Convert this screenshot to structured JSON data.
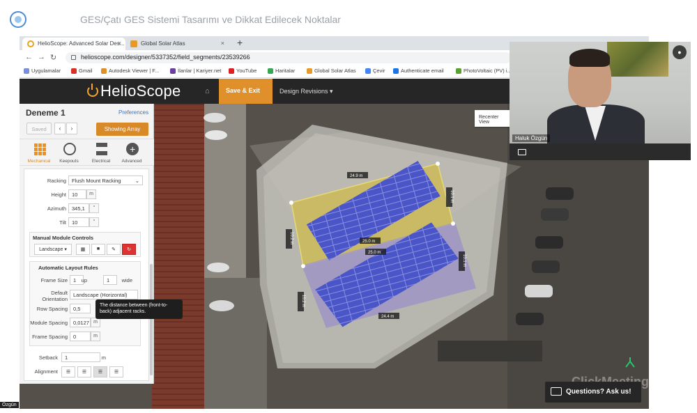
{
  "presentation": {
    "title": "GES/Çatı GES Sistemi Tasarımı ve Dikkat Edilecek Noktalar"
  },
  "browser": {
    "tabs": [
      {
        "label": "HelioScope: Advanced Solar Des...",
        "close": "×"
      },
      {
        "label": "Global Solar Atlas",
        "close": "×"
      }
    ],
    "new_tab": "+",
    "url": "helioscope.com/designer/5337352/field_segments/23539266",
    "bookmarks": [
      "Uygulamalar",
      "Gmail",
      "Autodesk Viewer | F...",
      "İlanlar | Kariyer.net",
      "YouTube",
      "Haritalar",
      "Global Solar Atlas",
      "Çevir",
      "Authenticate email",
      "PhotoVoltaic (PV) i..."
    ]
  },
  "app": {
    "brand": "HelioScope",
    "save_exit": "Save & Exit",
    "design_revisions": "Design Revisions ▾",
    "recenter": "Recenter View"
  },
  "panel": {
    "title": "Deneme 1",
    "preferences": "Preferences",
    "saved": "Saved",
    "prev": "‹",
    "next": "›",
    "showing": "Showing Array",
    "tools": [
      "Mechanical",
      "Keepouts",
      "Electrical",
      "Advanced"
    ],
    "racking_label": "Racking",
    "racking_value": "Flush Mount Racking",
    "height_label": "Height",
    "height_value": "10",
    "height_unit": "m",
    "azimuth_label": "Azimuth",
    "azimuth_value": "345,1",
    "azimuth_unit": "°",
    "tilt_label": "Tilt",
    "tilt_value": "10",
    "tilt_unit": "°",
    "manual_title": "Manual Module Controls",
    "landscape_btn": "Landscape ▾",
    "auto_title": "Automatic Layout Rules",
    "frame_size_label": "Frame Size",
    "frame_up_value": "1",
    "frame_up_unit": "up",
    "frame_wide_value": "1",
    "frame_wide_unit": "wide",
    "orientation_label": "Default Orientation",
    "orientation_value": "Landscape (Horizontal)",
    "row_spacing_label": "Row Spacing",
    "row_spacing_value": "0,5",
    "module_spacing_label": "Module Spacing",
    "module_spacing_value": "0,0127",
    "module_spacing_unit": "m",
    "frame_spacing_label": "Frame Spacing",
    "frame_spacing_value": "0",
    "frame_spacing_unit": "m",
    "setback_label": "Setback",
    "setback_value": "1",
    "setback_unit": "m",
    "alignment_label": "Alignment",
    "tooltip": "The distance between (front-to-back) adjacent racks."
  },
  "map": {
    "dims": [
      "24.9 m",
      "25.0 m",
      "25.0 m",
      "24.4 m",
      "10.1 m",
      "10.2 m",
      "10.1 m",
      "10.2 m"
    ]
  },
  "webcam": {
    "name": "Haluk Özgün"
  },
  "meeting": {
    "questions": "Questions? Ask us!",
    "brand": "ClickMeeting",
    "bottom_name": "Özgün"
  },
  "colors": {
    "accent": "#e0902a",
    "panel_blue": "#4a55c8",
    "selected_outline": "#e8d64a"
  }
}
